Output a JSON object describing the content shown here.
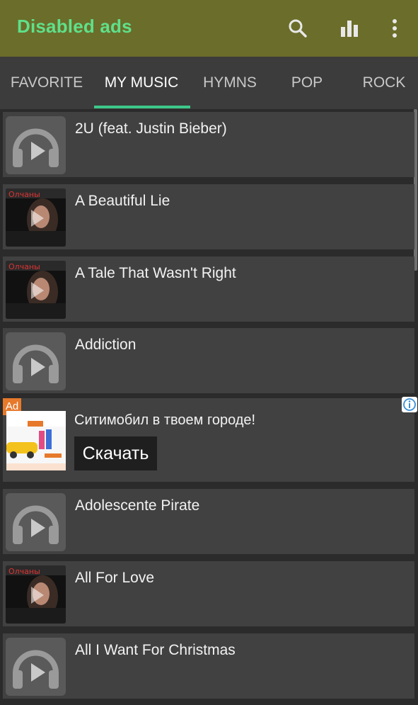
{
  "appbar": {
    "title": "Disabled ads",
    "actions": [
      "search-icon",
      "equalizer-icon",
      "more-vert-icon"
    ],
    "background": "#6b6d2a",
    "title_color": "#5fe08a"
  },
  "tabs": {
    "items": [
      {
        "label": "FAVORITE"
      },
      {
        "label": "MY MUSIC"
      },
      {
        "label": "HYMNS"
      },
      {
        "label": "POP"
      },
      {
        "label": "ROCK"
      }
    ],
    "active": "MY MUSIC",
    "indicator_color": "#3cc88a"
  },
  "songs": [
    {
      "title": "2U (feat. Justin Bieber)",
      "art": "headphones-icon"
    },
    {
      "title": "A Beautiful Lie",
      "art": "album-cover"
    },
    {
      "title": "A Tale That Wasn't Right",
      "art": "album-cover"
    },
    {
      "title": "Addiction",
      "art": "headphones-icon"
    },
    {
      "title": "Adolescente Pirate",
      "art": "headphones-icon"
    },
    {
      "title": "All For Love",
      "art": "album-cover"
    },
    {
      "title": "All I Want For Christmas",
      "art": "headphones-icon"
    }
  ],
  "ad": {
    "badge": "Ad",
    "title": "Ситимобил в твоем городе!",
    "button": "Скачать",
    "badge_color": "#e7792b"
  }
}
